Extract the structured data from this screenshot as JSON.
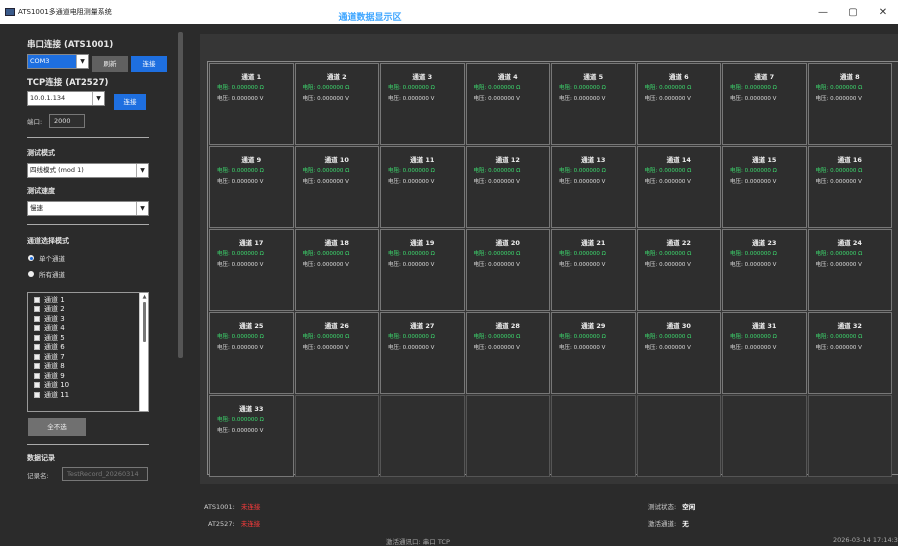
{
  "window": {
    "title": "ATS1001多通道电阻测量系统",
    "min": "—",
    "max": "▢",
    "close": "✕"
  },
  "serial": {
    "section_title": "串口连接 (ATS1001)",
    "port_value": "COM3",
    "refresh_label": "刷新",
    "connect_label": "连接"
  },
  "tcp": {
    "section_title": "TCP连接 (AT2527)",
    "ip_value": "10.0.1.134",
    "connect_label": "连接",
    "port_label": "端口:",
    "port_value": "2000"
  },
  "test": {
    "mode_title": "测试模式",
    "mode_value": "四线模式 (mod 1)",
    "speed_title": "测试速度",
    "speed_value": "慢速"
  },
  "channel_select": {
    "title": "通道选择模式",
    "single_label": "单个通道",
    "all_label": "所有通道",
    "list": [
      "通道 1",
      "通道 2",
      "通道 3",
      "通道 4",
      "通道 5",
      "通道 6",
      "通道 7",
      "通道 8",
      "通道 9",
      "通道 10",
      "通道 11"
    ],
    "deselect_label": "全不选"
  },
  "record": {
    "title": "数据记录",
    "name_label": "记录名:",
    "name_placeholder": "TestRecord_20260314"
  },
  "display": {
    "title": "通道数据显示区",
    "resistance_text": "电阻: 0.000000 Ω",
    "voltage_text": "电压: 0.000000 V",
    "channels": [
      "通道 1",
      "通道 2",
      "通道 3",
      "通道 4",
      "通道 5",
      "通道 6",
      "通道 7",
      "通道 8",
      "通道 9",
      "通道 10",
      "通道 11",
      "通道 12",
      "通道 13",
      "通道 14",
      "通道 15",
      "通道 16",
      "通道 17",
      "通道 18",
      "通道 19",
      "通道 20",
      "通道 21",
      "通道 22",
      "通道 23",
      "通道 24",
      "通道 25",
      "通道 26",
      "通道 27",
      "通道 28",
      "通道 29",
      "通道 30",
      "通道 31",
      "通道 32",
      "通道 33"
    ]
  },
  "status": {
    "ats_label": "ATS1001:",
    "ats_value": "未连接",
    "at_label": "AT2527:",
    "at_value": "未连接",
    "test_state_label": "测试状态:",
    "test_state_value": "空闲",
    "active_label": "激活通道:",
    "active_value": "无",
    "footer_text": "激活通讯口: 串口 TCP",
    "timestamp": "2026-03-14 17:14:3"
  },
  "colors": {
    "accent": "#1e6fe0",
    "title_blue": "#3fa6ff",
    "resistance_green": "#3ddc6f",
    "error_red": "#ff3b3b"
  }
}
